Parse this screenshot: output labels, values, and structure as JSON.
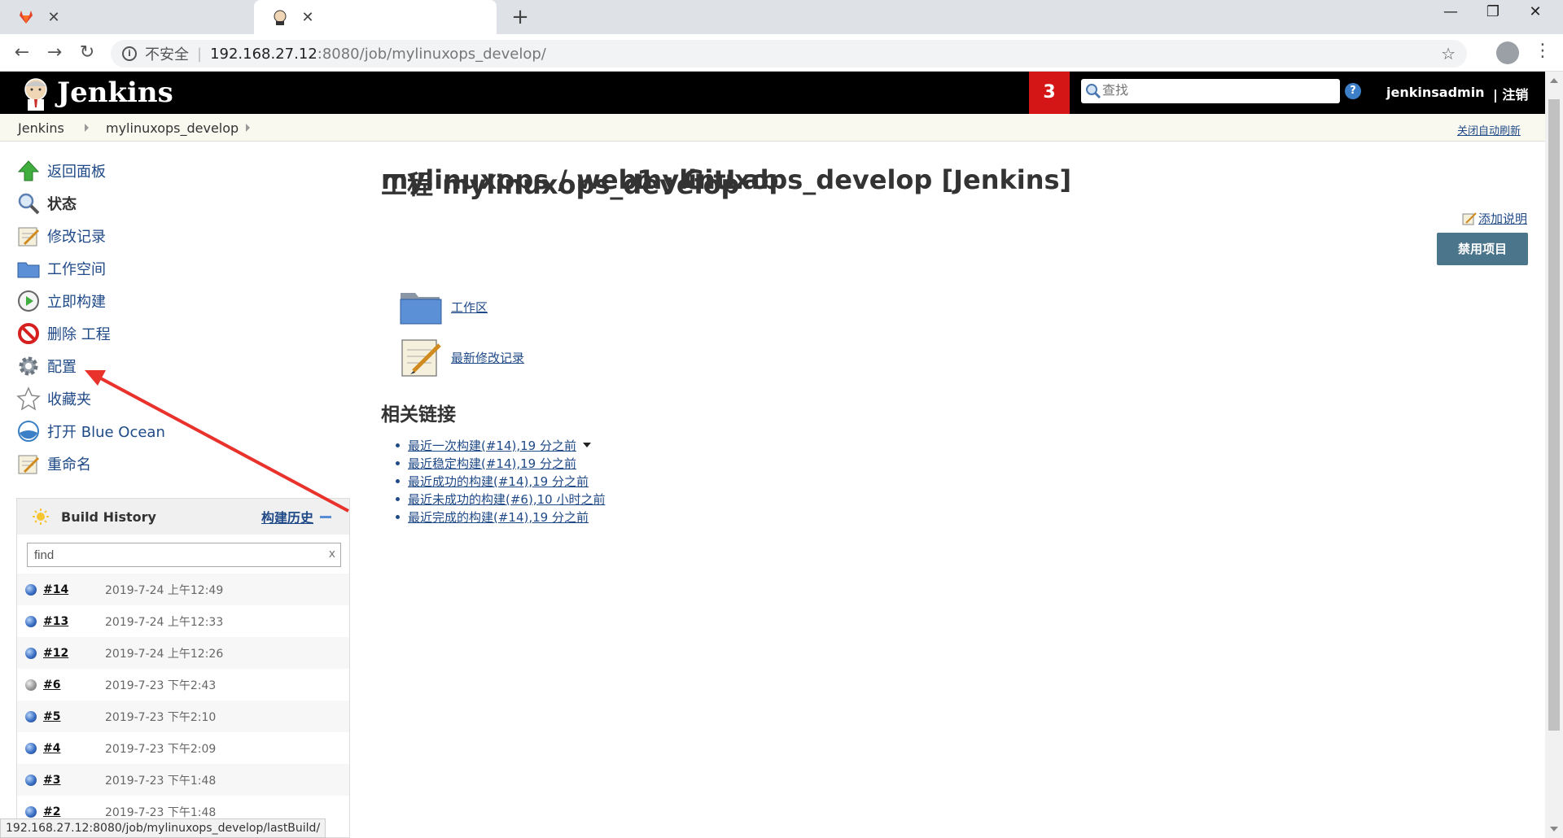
{
  "browser": {
    "tabs": [
      {
        "title": "mylinuxops / web1 · GitLab",
        "active": false
      },
      {
        "title": "mylinuxops_develop [Jenkins]",
        "active": true
      }
    ],
    "address": {
      "security": "不安全",
      "host": "192.168.27.12",
      "path": ":8080/job/mylinuxops_develop/"
    },
    "status_url": "192.168.27.12:8080/job/mylinuxops_develop/lastBuild/"
  },
  "header": {
    "brand": "Jenkins",
    "notification_count": "3",
    "search_placeholder": "查找",
    "help": "?",
    "user": "jenkinsadmin",
    "logout": "| 注销"
  },
  "breadcrumb": {
    "items": [
      "Jenkins",
      "mylinuxops_develop"
    ],
    "auto_refresh": "关闭自动刷新"
  },
  "sidebar": {
    "tasks": [
      {
        "label": "返回面板",
        "icon": "up-arrow-icon"
      },
      {
        "label": "状态",
        "icon": "search-icon"
      },
      {
        "label": "修改记录",
        "icon": "notepad-icon"
      },
      {
        "label": "工作空间",
        "icon": "folder-icon"
      },
      {
        "label": "立即构建",
        "icon": "clock-icon"
      },
      {
        "label": "删除 工程",
        "icon": "no-entry-icon"
      },
      {
        "label": "配置",
        "icon": "gear-icon"
      },
      {
        "label": "收藏夹",
        "icon": "star-icon"
      },
      {
        "label": "打开 Blue Ocean",
        "icon": "blue-ocean-icon"
      },
      {
        "label": "重命名",
        "icon": "notepad-icon"
      }
    ]
  },
  "build_history": {
    "title": "Build History",
    "trend_link": "构建历史",
    "filter_value": "find",
    "clear": "x",
    "builds": [
      {
        "number": "#14",
        "date": "2019-7-24 上午12:49",
        "status": "blue"
      },
      {
        "number": "#13",
        "date": "2019-7-24 上午12:33",
        "status": "blue"
      },
      {
        "number": "#12",
        "date": "2019-7-24 上午12:26",
        "status": "blue"
      },
      {
        "number": "#6",
        "date": "2019-7-23 下午2:43",
        "status": "grey"
      },
      {
        "number": "#5",
        "date": "2019-7-23 下午2:10",
        "status": "blue"
      },
      {
        "number": "#4",
        "date": "2019-7-23 下午2:09",
        "status": "blue"
      },
      {
        "number": "#3",
        "date": "2019-7-23 下午1:48",
        "status": "blue"
      },
      {
        "number": "#2",
        "date": "2019-7-23 下午1:48",
        "status": "blue"
      }
    ]
  },
  "main": {
    "title": "工程 mylinuxops_develop",
    "add_description": "添加说明",
    "disable_button": "禁用项目",
    "workspace_link": "工作区",
    "changes_link": "最新修改记录",
    "related_title": "相关链接",
    "related_links": [
      "最近一次构建(#14),19 分之前",
      "最近稳定构建(#14),19 分之前",
      "最近成功的构建(#14),19 分之前",
      "最近未成功的构建(#6),10 小时之前",
      "最近完成的构建(#14),19 分之前"
    ]
  },
  "colors": {
    "header_bg": "#000000",
    "badge": "#d41616",
    "link": "#204a87",
    "disable_button": "#4b758b",
    "annotation_arrow": "#e8322b"
  }
}
